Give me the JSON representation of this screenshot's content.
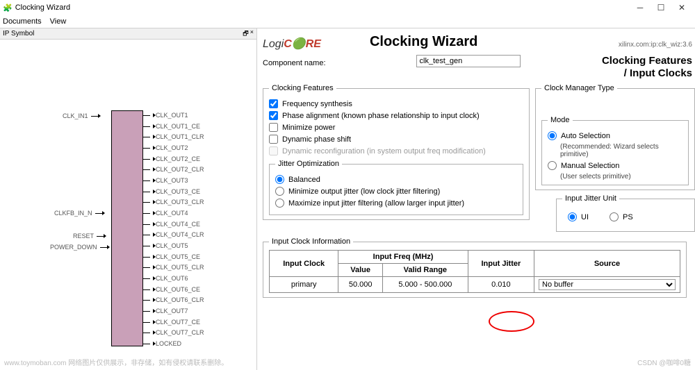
{
  "window": {
    "title": "Clocking Wizard"
  },
  "menu": {
    "documents": "Documents",
    "view": "View"
  },
  "panel": {
    "title": "IP Symbol",
    "dock": "🗗",
    "close": "×"
  },
  "pins": {
    "left": [
      "CLK_IN1",
      "CLKFB_IN_N",
      "RESET",
      "POWER_DOWN"
    ],
    "right": [
      "CLK_OUT1",
      "CLK_OUT1_CE",
      "CLK_OUT1_CLR",
      "CLK_OUT2",
      "CLK_OUT2_CE",
      "CLK_OUT2_CLR",
      "CLK_OUT3",
      "CLK_OUT3_CE",
      "CLK_OUT3_CLR",
      "CLK_OUT4",
      "CLK_OUT4_CE",
      "CLK_OUT4_CLR",
      "CLK_OUT5",
      "CLK_OUT5_CE",
      "CLK_OUT5_CLR",
      "CLK_OUT6",
      "CLK_OUT6_CE",
      "CLK_OUT6_CLR",
      "CLK_OUT7",
      "CLK_OUT7_CE",
      "CLK_OUT7_CLR",
      "LOCKED"
    ]
  },
  "header": {
    "logo": "LogiC🔴RE",
    "title": "Clocking Wizard",
    "ipid": "xilinx.com:ip:clk_wiz:3.6",
    "comp_label": "Component name:",
    "comp_value": "clk_test_gen",
    "subtitle1": "Clocking Features",
    "subtitle2": "/ Input Clocks"
  },
  "features": {
    "legend": "Clocking Features",
    "freq": "Frequency synthesis",
    "phase": "Phase alignment (known phase relationship to input clock)",
    "min_power": "Minimize power",
    "dyn_shift": "Dynamic phase shift",
    "dyn_reconf": "Dynamic reconfiguration (in system output freq modification)",
    "jitter": {
      "legend": "Jitter Optimization",
      "balanced": "Balanced",
      "min_out": "Minimize output jitter (low clock jitter filtering)",
      "max_in": "Maximize input jitter filtering (allow larger input jitter)"
    }
  },
  "cmt": {
    "legend": "Clock Manager Type",
    "mode_legend": "Mode",
    "auto": "Auto Selection",
    "auto_note": "(Recommended:  Wizard selects primitive)",
    "manual": "Manual Selection",
    "manual_note": "(User selects primitive)"
  },
  "jitter_unit": {
    "legend": "Input Jitter Unit",
    "ui": "UI",
    "ps": "PS"
  },
  "clock_info": {
    "legend": "Input Clock Information",
    "h_clock": "Input Clock",
    "h_freq": "Input Freq (MHz)",
    "h_value": "Value",
    "h_range": "Valid Range",
    "h_jitter": "Input Jitter",
    "h_source": "Source",
    "r_name": "primary",
    "r_value": "50.000",
    "r_range": "5.000 - 500.000",
    "r_jitter": "0.010",
    "r_source": "No buffer"
  },
  "footer": {
    "watermark": "www.toymoban.com 网络图片仅供展示，非存储，如有侵权请联系删除。",
    "credit": "CSDN @咖啡0糖"
  }
}
